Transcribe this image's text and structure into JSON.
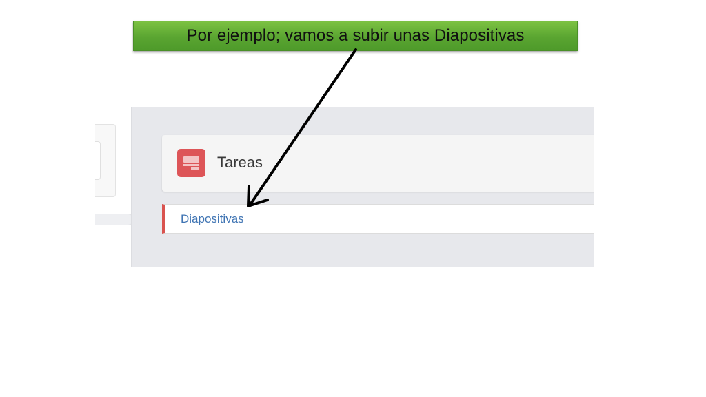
{
  "callout": {
    "text": "Por ejemplo; vamos a subir unas Diapositivas",
    "color": "#5aa531"
  },
  "card": {
    "title": "Tareas",
    "icon": "tasks-icon",
    "icon_color": "#dd5558"
  },
  "resource": {
    "link_label": "Diapositivas",
    "accent_color": "#d9534f",
    "link_color": "#3f74b3"
  },
  "annotation": {
    "arrow_icon": "arrow-down-left-icon",
    "arrow_color": "#000000"
  }
}
